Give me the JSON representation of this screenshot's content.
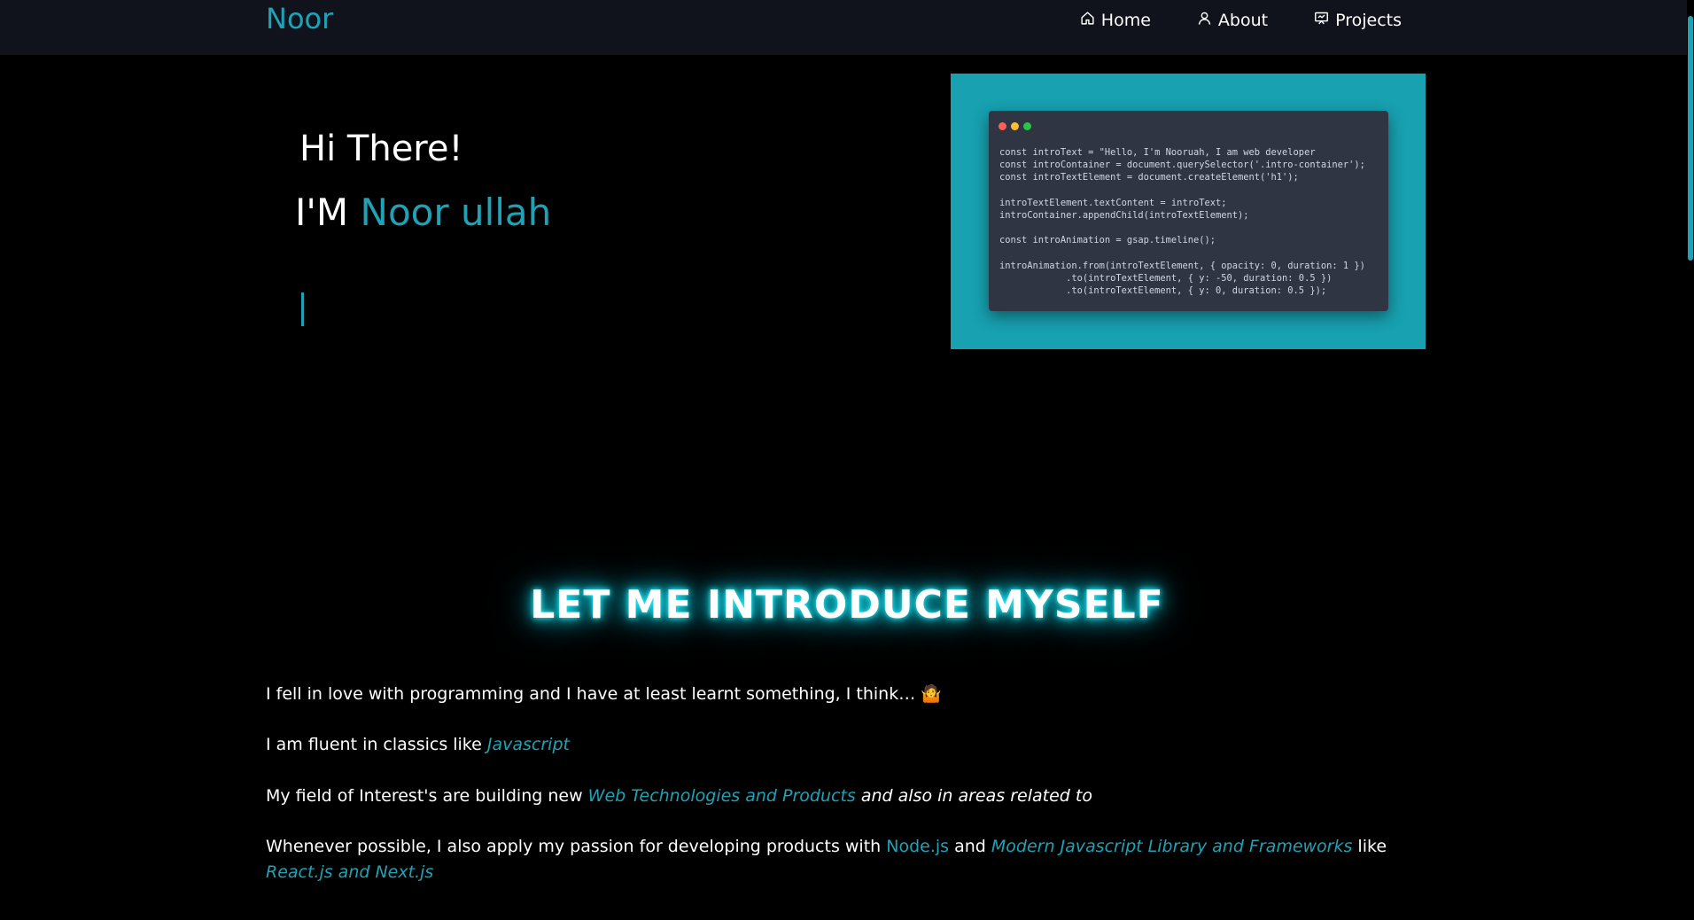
{
  "brand": "Noor",
  "nav": {
    "home": "Home",
    "about": "About",
    "projects": "Projects"
  },
  "hero": {
    "greeting": "Hi There!",
    "im_prefix": "I'M ",
    "name": "Noor ullah"
  },
  "code_snippet": {
    "lines": [
      "const introText = \"Hello, I'm Nooruah, I am web developer",
      "const introContainer = document.querySelector('.intro-container');",
      "const introTextElement = document.createElement('h1');",
      "",
      "introTextElement.textContent = introText;",
      "introContainer.appendChild(introTextElement);",
      "",
      "const introAnimation = gsap.timeline();",
      "",
      "introAnimation.from(introTextElement, { opacity: 0, duration: 1 })",
      "            .to(introTextElement, { y: -50, duration: 0.5 })",
      "            .to(introTextElement, { y: 0, duration: 0.5 });"
    ]
  },
  "intro": {
    "title": "LET ME INTRODUCE MYSELF",
    "p1": "I fell in love with programming and I have at least learnt something, I think… 🤷",
    "p2_text": "I am fluent in classics like ",
    "p2_highlight": "Javascript",
    "p3_text": "My field of Interest's are building new ",
    "p3_highlight": "Web Technologies and Products",
    "p3_tail": " and also in areas related to",
    "p4_text": "Whenever possible, I also apply my passion for developing products with ",
    "p4_node": "Node.js",
    "p4_and": " and ",
    "p4_frameworks": "Modern Javascript Library and Frameworks",
    "p4_like": "  like ",
    "p4_react": "React.js and Next.js"
  },
  "colors": {
    "accent": "#1fa2b5",
    "navbar_bg": "#10121c",
    "code_frame": "#17a1b1",
    "code_window": "#2f3542",
    "glow": "#13d7e8"
  },
  "icons": {
    "home": "home-icon",
    "about": "user-icon",
    "projects": "presentation-icon"
  }
}
